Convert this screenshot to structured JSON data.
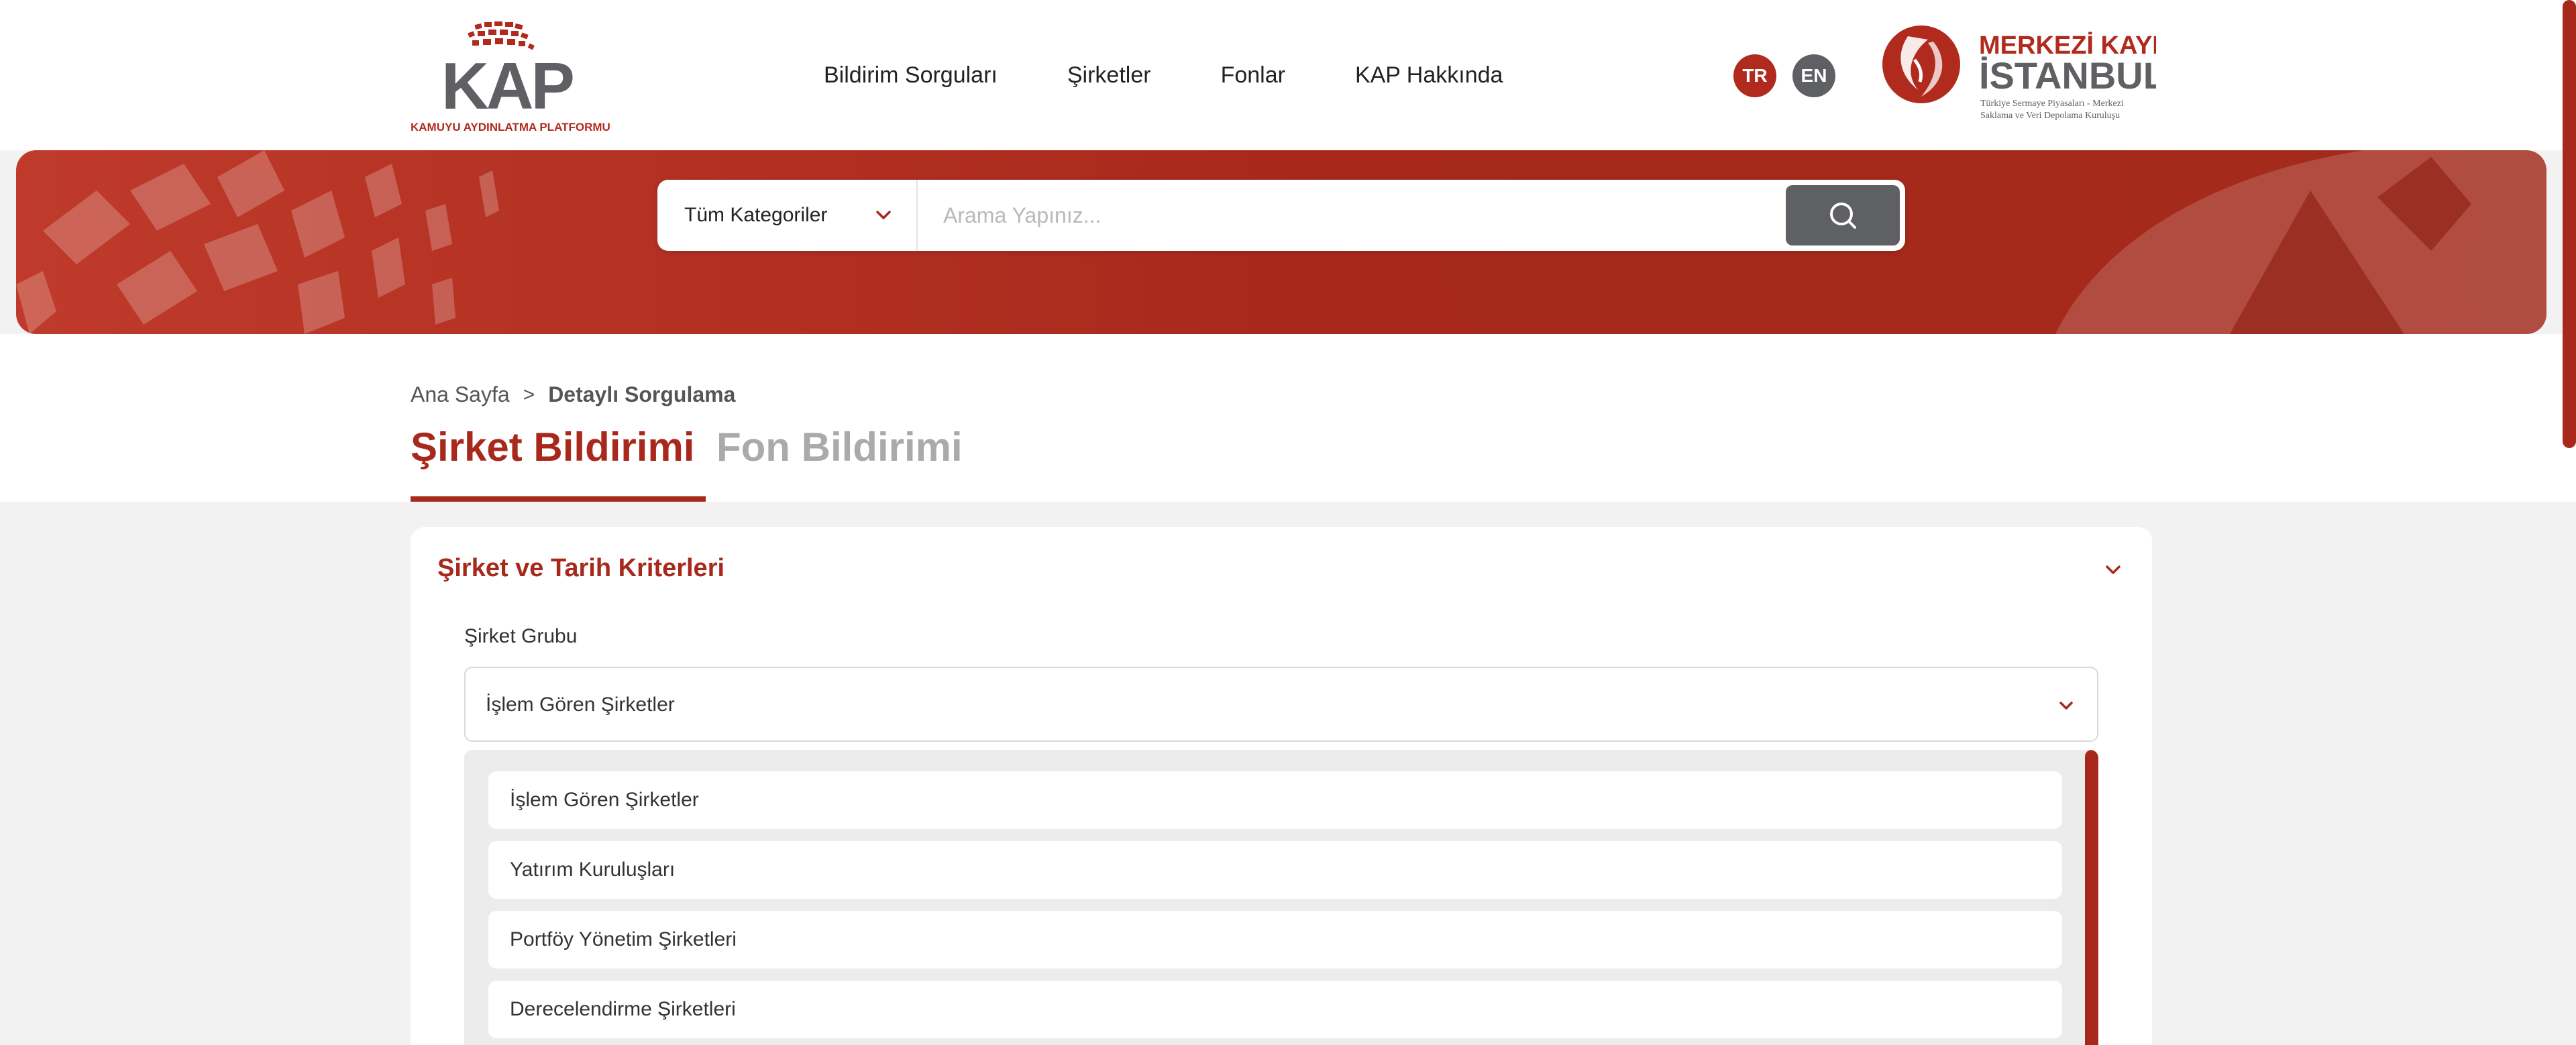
{
  "header": {
    "kap_logo": {
      "text": "KAP",
      "subtitle": "KAMUYU AYDINLATMA PLATFORMU"
    },
    "nav": [
      "Bildirim Sorguları",
      "Şirketler",
      "Fonlar",
      "KAP Hakkında"
    ],
    "languages": {
      "tr": "TR",
      "en": "EN"
    },
    "mkk_logo": {
      "line1": "MERKEZİ KAYIT",
      "line2": "İSTANBUL",
      "tagline1": "Türkiye Sermaye Piyasaları - Merkezi",
      "tagline2": "Saklama ve Veri Depolama Kuruluşu"
    }
  },
  "search": {
    "category": "Tüm Kategoriler",
    "placeholder": "Arama Yapınız..."
  },
  "breadcrumb": {
    "home": "Ana Sayfa",
    "separator": ">",
    "current": "Detaylı Sorgulama"
  },
  "tabs": {
    "company": "Şirket Bildirimi",
    "fund": "Fon Bildirimi"
  },
  "criteria": {
    "title": "Şirket ve Tarih Kriterleri",
    "group_label": "Şirket Grubu",
    "group_value": "İşlem Gören Şirketler",
    "options": [
      "İşlem Gören Şirketler",
      "Yatırım Kuruluşları",
      "Portföy Yönetim Şirketleri",
      "Derecelendirme Şirketleri"
    ]
  },
  "colors": {
    "brand": "#a8291c",
    "grey_button": "#5f6063"
  },
  "icons": [
    "chevron-down-icon",
    "search-icon"
  ]
}
